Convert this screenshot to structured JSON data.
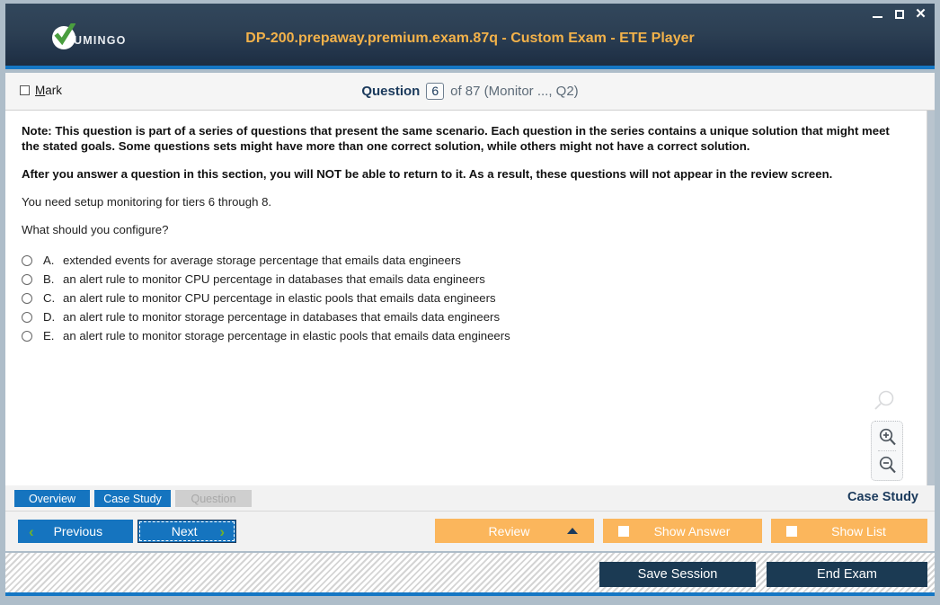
{
  "window": {
    "title": "DP-200.prepaway.premium.exam.87q - Custom Exam - ETE Player",
    "logo_text": "UMINGO",
    "controls": {
      "minimize": "minimize-icon",
      "maximize": "maximize-icon",
      "close": "✕"
    },
    "accent_color": "#1577c4",
    "title_color": "#f3b24a"
  },
  "question_header": {
    "mark_accel": "M",
    "mark_label_rest": "ark",
    "question_word": "Question",
    "question_number": "6",
    "question_of": "of 87 (Monitor ..., Q2)"
  },
  "question": {
    "note_paragraph": "Note: This question is part of a series of questions that present the same scenario. Each question in the series contains a unique solution that might meet the stated goals. Some questions sets might have more than one correct solution, while others might not have a correct solution.",
    "warning_paragraph": "After you answer a question in this section, you will NOT be able to return to it. As a result, these questions will not appear in the review screen.",
    "scenario": "You need setup monitoring for tiers 6 through 8.",
    "prompt": "What should you configure?",
    "options": [
      {
        "letter": "A.",
        "text": "extended events for average storage percentage that emails data engineers"
      },
      {
        "letter": "B.",
        "text": "an alert rule to monitor CPU percentage in databases that emails data engineers"
      },
      {
        "letter": "C.",
        "text": "an alert rule to monitor CPU percentage in elastic pools that emails data engineers"
      },
      {
        "letter": "D.",
        "text": "an alert rule to monitor storage percentage in databases that emails data engineers"
      },
      {
        "letter": "E.",
        "text": "an alert rule to monitor storage percentage in elastic pools that emails data engineers"
      }
    ]
  },
  "zoom_controls": {
    "ghost": "magnifier-icon",
    "zoom_in": "zoom-in-icon",
    "zoom_out": "zoom-out-icon"
  },
  "tabs": [
    {
      "label": "Overview",
      "state": "active"
    },
    {
      "label": "Case Study",
      "state": "active"
    },
    {
      "label": "Question",
      "state": "disabled"
    }
  ],
  "section_label": "Case Study",
  "nav": {
    "previous": "Previous",
    "next": "Next",
    "prev_chevron": "‹",
    "next_chevron": "›"
  },
  "actions": {
    "review": "Review",
    "show_answer": "Show Answer",
    "show_list": "Show List"
  },
  "footer": {
    "save_session": "Save Session",
    "end_exam": "End Exam"
  }
}
